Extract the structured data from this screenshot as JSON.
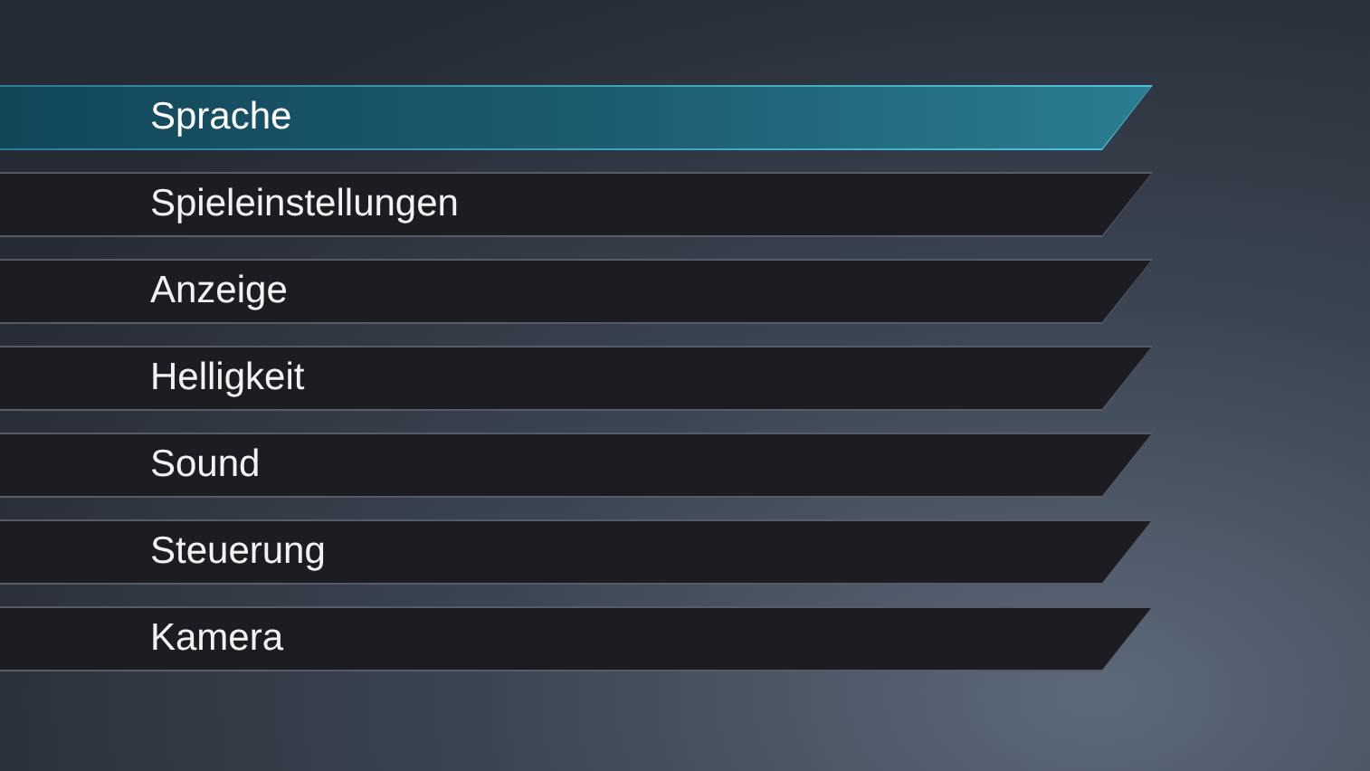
{
  "menu": {
    "items": [
      {
        "label": "Sprache",
        "selected": true
      },
      {
        "label": "Spieleinstellungen",
        "selected": false
      },
      {
        "label": "Anzeige",
        "selected": false
      },
      {
        "label": "Helligkeit",
        "selected": false
      },
      {
        "label": "Sound",
        "selected": false
      },
      {
        "label": "Steuerung",
        "selected": false
      },
      {
        "label": "Kamera",
        "selected": false
      }
    ]
  }
}
